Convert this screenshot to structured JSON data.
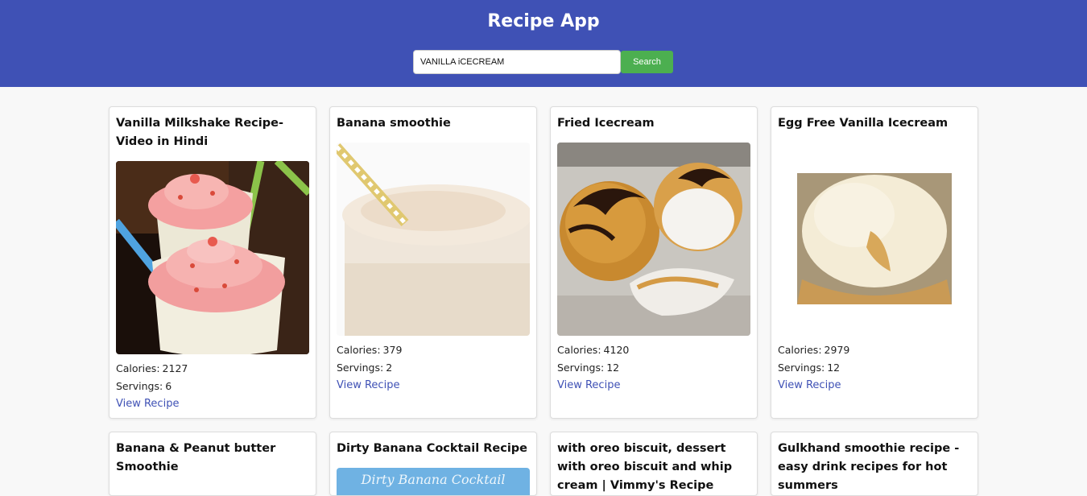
{
  "app": {
    "title": "Recipe App"
  },
  "search": {
    "value": "VANILLA iCECREAM",
    "button_label": "Search"
  },
  "labels": {
    "calories": "Calories:",
    "servings": "Servings:",
    "view_recipe": "View Recipe"
  },
  "recipes": [
    {
      "title": "Vanilla Milkshake Recipe-Video in Hindi",
      "calories": "2127",
      "servings": "6",
      "image": "pink-milkshake-photo"
    },
    {
      "title": "Banana smoothie",
      "calories": "379",
      "servings": "2",
      "image": "banana-smoothie-photo"
    },
    {
      "title": "Fried Icecream",
      "calories": "4120",
      "servings": "12",
      "image": "fried-icecream-photo"
    },
    {
      "title": "Egg Free Vanilla Icecream",
      "calories": "2979",
      "servings": "12",
      "image": "vanilla-icecream-photo"
    },
    {
      "title": "Banana & Peanut butter Smoothie"
    },
    {
      "title": "Dirty Banana Cocktail Recipe",
      "image_caption": "Dirty Banana Cocktail"
    },
    {
      "title": "with oreo biscuit, dessert with oreo biscuit and whip cream | Vimmy's Recipe World"
    },
    {
      "title": "Gulkhand smoothie recipe - easy drink recipes for hot summers"
    }
  ],
  "colors": {
    "header": "#3f51b5",
    "search_button": "#4caf50",
    "link": "#3f51b5"
  }
}
